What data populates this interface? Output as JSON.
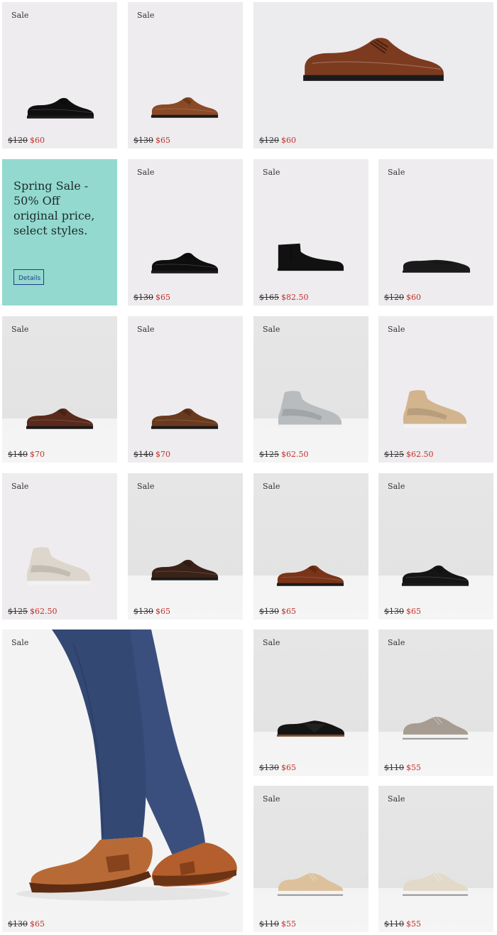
{
  "promo": {
    "headline": "Spring Sale - 50% Off original price, select styles.",
    "details_label": "Details",
    "background_color": "#93d9cf",
    "button_color": "#223c8a"
  },
  "colors": {
    "sale_price": "#c0302b",
    "card_background": "#eeecee"
  },
  "products": [
    {
      "id": "p1",
      "badge": "Sale",
      "original_price": "$120",
      "sale_price": "$60",
      "icon": "black-oxford-shoe-icon"
    },
    {
      "id": "p2",
      "badge": "Sale",
      "original_price": "$130",
      "sale_price": "$65",
      "icon": "brown-oxford-shoe-icon"
    },
    {
      "id": "p3",
      "badge": "",
      "original_price": "$120",
      "sale_price": "$60",
      "icon": "brown-oxford-shoe-icon"
    },
    {
      "id": "p4",
      "badge": "Sale",
      "original_price": "$130",
      "sale_price": "$65",
      "icon": "black-oxford-shoe-icon"
    },
    {
      "id": "p5",
      "badge": "Sale",
      "original_price": "$165",
      "sale_price": "$82.50",
      "icon": "black-chelsea-boot-icon"
    },
    {
      "id": "p6",
      "badge": "Sale",
      "original_price": "$120",
      "sale_price": "$60",
      "icon": "black-loafer-icon"
    },
    {
      "id": "p7",
      "badge": "Sale",
      "original_price": "$140",
      "sale_price": "$70",
      "icon": "brown-derby-shoe-icon"
    },
    {
      "id": "p8",
      "badge": "Sale",
      "original_price": "$140",
      "sale_price": "$70",
      "icon": "brown-suede-derby-icon"
    },
    {
      "id": "p9",
      "badge": "Sale",
      "original_price": "$125",
      "sale_price": "$62.50",
      "icon": "grey-high-top-sneaker-icon"
    },
    {
      "id": "p10",
      "badge": "Sale",
      "original_price": "$125",
      "sale_price": "$62.50",
      "icon": "tan-high-top-sneaker-icon"
    },
    {
      "id": "p11",
      "badge": "Sale",
      "original_price": "$125",
      "sale_price": "$62.50",
      "icon": "cream-high-top-sneaker-icon"
    },
    {
      "id": "p12",
      "badge": "Sale",
      "original_price": "$130",
      "sale_price": "$65",
      "icon": "dark-brown-derby-icon"
    },
    {
      "id": "p13",
      "badge": "Sale",
      "original_price": "$130",
      "sale_price": "$65",
      "icon": "brown-derby-shoe-icon"
    },
    {
      "id": "p14",
      "badge": "Sale",
      "original_price": "$130",
      "sale_price": "$65",
      "icon": "black-derby-shoe-icon"
    },
    {
      "id": "p15",
      "badge": "Sale",
      "original_price": "$130",
      "sale_price": "$65",
      "icon": "model-wearing-brown-loafers-photo"
    },
    {
      "id": "p16",
      "badge": "Sale",
      "original_price": "$130",
      "sale_price": "$65",
      "icon": "black-slip-on-shoe-icon"
    },
    {
      "id": "p17",
      "badge": "Sale",
      "original_price": "$110",
      "sale_price": "$55",
      "icon": "grey-knit-sneaker-icon"
    },
    {
      "id": "p18",
      "badge": "Sale",
      "original_price": "$110",
      "sale_price": "$55",
      "icon": "beige-knit-sneaker-icon"
    },
    {
      "id": "p19",
      "badge": "Sale",
      "original_price": "$110",
      "sale_price": "$55",
      "icon": "cream-knit-sneaker-icon"
    }
  ]
}
